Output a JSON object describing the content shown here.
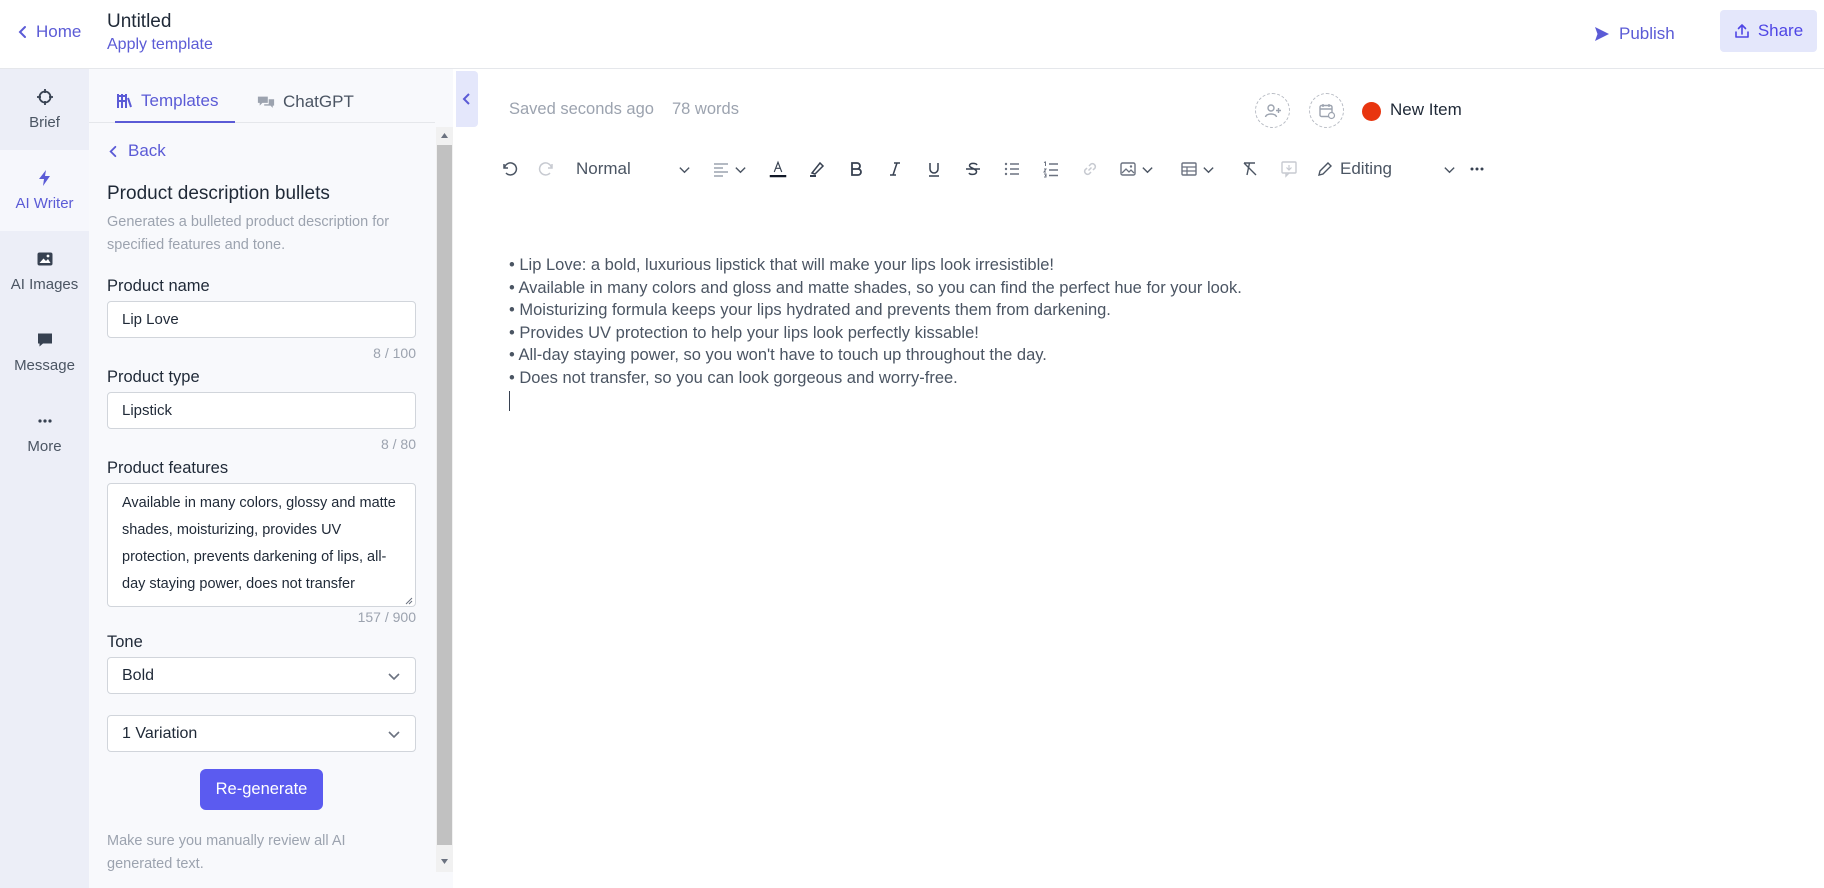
{
  "topbar": {
    "home_label": "Home",
    "doc_title": "Untitled",
    "apply_template": "Apply template",
    "publish_label": "Publish",
    "share_label": "Share"
  },
  "rail": {
    "items": [
      {
        "label": "Brief",
        "icon": "crosshair-icon"
      },
      {
        "label": "AI Writer",
        "icon": "lightning-icon",
        "active": true
      },
      {
        "label": "AI Images",
        "icon": "image-icon"
      },
      {
        "label": "Message",
        "icon": "chat-icon"
      },
      {
        "label": "More",
        "icon": "more-dots-icon"
      }
    ]
  },
  "panel": {
    "tabs": [
      {
        "label": "Templates",
        "active": true
      },
      {
        "label": "ChatGPT"
      }
    ],
    "back_label": "Back",
    "template_title": "Product description bullets",
    "template_description": "Generates a bulleted product description for specified features and tone.",
    "fields": {
      "product_name": {
        "label": "Product name",
        "value": "Lip Love",
        "counter": "8 / 100"
      },
      "product_type": {
        "label": "Product type",
        "value": "Lipstick",
        "counter": "8 / 80"
      },
      "product_features": {
        "label": "Product features",
        "value": "Available in many colors, glossy and matte shades, moisturizing, provides UV protection, prevents darkening of lips, all-day staying power, does not transfer",
        "counter": "157 / 900"
      },
      "tone": {
        "label": "Tone",
        "value": "Bold"
      },
      "variations": {
        "value": "1 Variation"
      }
    },
    "regenerate_label": "Re-generate",
    "disclaimer": "Make sure you manually review all AI generated text."
  },
  "editor": {
    "saved_status": "Saved seconds ago",
    "word_count": "78 words",
    "status_name": "New Item",
    "status_color": "#e8350f",
    "toolbar": {
      "style_label": "Normal",
      "mode_label": "Editing"
    },
    "lines": [
      "• Lip Love: a bold, luxurious lipstick that will make your lips look irresistible!",
      "• Available in many colors and gloss and matte shades, so you can find the perfect hue for your look.",
      "• Moisturizing formula keeps your lips hydrated and prevents them from darkening.",
      "• Provides UV protection to help your lips look perfectly kissable!",
      "• All-day staying power, so you won't have to touch up throughout the day.",
      "• Does not transfer, so you can look gorgeous and worry-free."
    ]
  },
  "colors": {
    "accent": "#5b5bd6",
    "button": "#5b5bf0",
    "share_bg": "#e4e7fb",
    "rail_bg": "#eceef7"
  }
}
